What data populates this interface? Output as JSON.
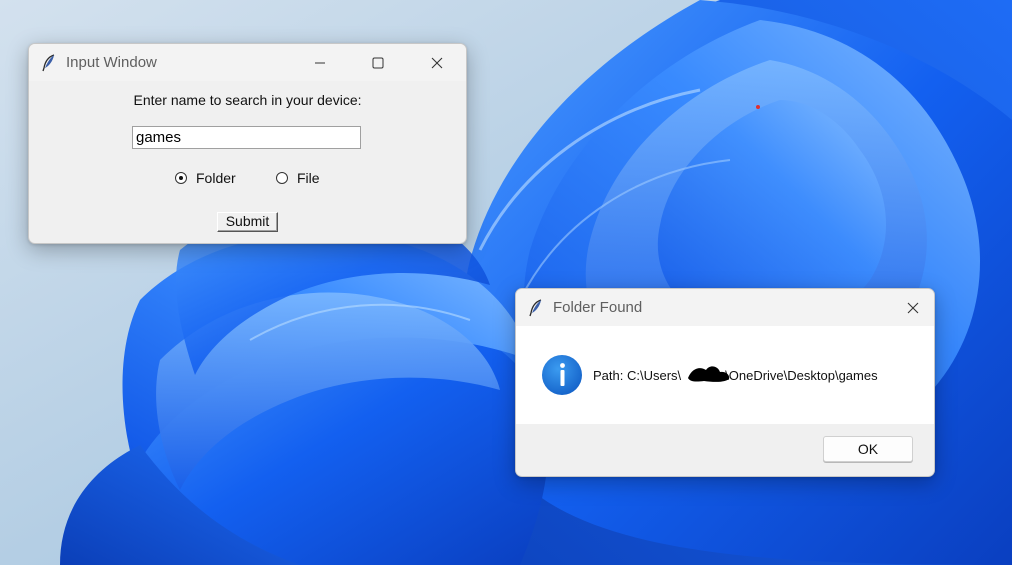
{
  "input_window": {
    "title": "Input Window",
    "icon": "feather-icon",
    "prompt": "Enter name to search in your device:",
    "search_value": "games",
    "radio_folder": "Folder",
    "radio_file": "File",
    "selected": "Folder",
    "submit_label": "Submit"
  },
  "found_dialog": {
    "title": "Folder Found",
    "icon": "feather-icon",
    "message_icon": "info-icon",
    "path_prefix": "Path: C:\\Users\\",
    "path_suffix": "\\OneDrive\\Desktop\\games",
    "ok_label": "OK"
  },
  "colors": {
    "window_bg": "#f0f0f0",
    "info_blue": "#1a6fd1",
    "wallpaper_blue": "#1d6cf2"
  }
}
